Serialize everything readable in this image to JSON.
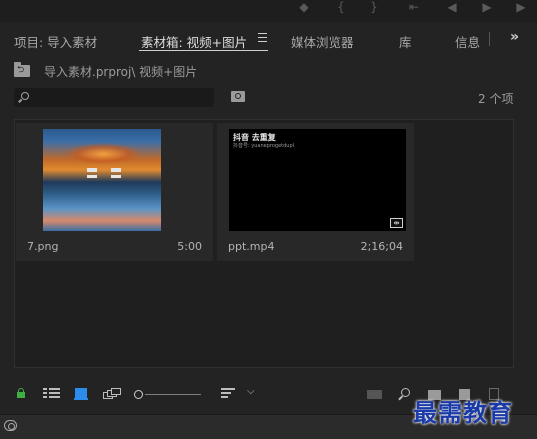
{
  "top_controls": [
    "marker-icon",
    "in-icon",
    "out-icon",
    "go-to-in-icon",
    "step-back-icon",
    "play-icon",
    "step-forward-icon"
  ],
  "tabs": [
    {
      "label": "项目: 导入素材",
      "active": false
    },
    {
      "label": "素材箱: 视频+图片",
      "active": true
    },
    {
      "label": "媒体浏览器",
      "active": false
    },
    {
      "label": "库",
      "active": false
    },
    {
      "label": "信息",
      "active": false
    }
  ],
  "overflow_label": "»",
  "path": {
    "text": "导入素材.prproj\\ 视频+图片"
  },
  "search": {
    "value": "",
    "placeholder": ""
  },
  "item_count": "2 个项",
  "items": [
    {
      "name": "7.png",
      "duration": "5:00",
      "type": "image"
    },
    {
      "name": "ppt.mp4",
      "duration": "2;16;04",
      "type": "video",
      "thumb_text": "抖音号: yuaneprogetdupl",
      "thumb_logo": "抖音 去重复"
    }
  ],
  "watermark": "最需教育",
  "colors": {
    "accent_blue": "#2d8ceb",
    "lock_green": "#3cb043",
    "watermark": "#1a3aa8"
  }
}
